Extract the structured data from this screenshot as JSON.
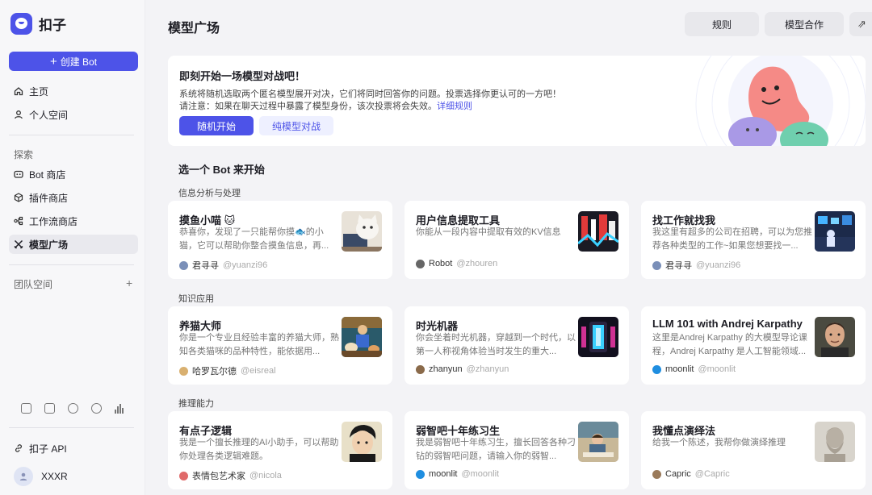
{
  "brand": {
    "name": "扣子"
  },
  "sidebar": {
    "create_label": "创建 Bot",
    "nav_top": [
      {
        "label": "主页",
        "icon": "home-icon"
      },
      {
        "label": "个人空间",
        "icon": "person-icon"
      }
    ],
    "explore_label": "探索",
    "nav_explore": [
      {
        "label": "Bot 商店",
        "icon": "bot-icon"
      },
      {
        "label": "插件商店",
        "icon": "cube-icon"
      },
      {
        "label": "工作流商店",
        "icon": "workflow-icon"
      },
      {
        "label": "模型广场",
        "icon": "arena-icon",
        "active": true
      }
    ],
    "team_label": "团队空间",
    "api_label": "扣子 API",
    "user_name": "XXXR"
  },
  "header": {
    "title": "模型广场",
    "rules_label": "规则",
    "coop_label": "模型合作"
  },
  "hero": {
    "title": "即刻开始一场模型对战吧！",
    "line1": "系统将随机选取两个匿名模型展开对决，它们将同时回答你的问题。投票选择你更认可的一方吧！",
    "line2": "请注意：如果在聊天过程中暴露了模型身份，该次投票将会失效。",
    "link": "详细规则",
    "btn_random": "随机开始",
    "btn_pure": "纯模型对战"
  },
  "pick_title": "选一个 Bot 来开始",
  "categories": [
    {
      "label": "信息分析与处理",
      "cards": [
        {
          "title": "摸鱼小喵 🐱",
          "desc": "恭喜你，发现了一只能帮你摸🐟的小猫，它可以帮助你整合摸鱼信息，再...",
          "author": "君寻寻",
          "handle": "@yuanzi96",
          "dot": "#7a8fb8"
        },
        {
          "title": "用户信息提取工具",
          "desc": "你能从一段内容中提取有效的KV信息",
          "author": "Robot",
          "handle": "@zhouren",
          "dot": "#666"
        },
        {
          "title": "找工作就找我",
          "desc": "我这里有超多的公司在招聘，可以为您推荐各种类型的工作~如果您想要找一...",
          "author": "君寻寻",
          "handle": "@yuanzi96",
          "dot": "#7a8fb8"
        }
      ]
    },
    {
      "label": "知识应用",
      "cards": [
        {
          "title": "养猫大师",
          "desc": "你是一个专业且经验丰富的养猫大师，熟知各类猫咪的品种特性，能依据用...",
          "author": "哈罗瓦尔德",
          "handle": "@eisreal",
          "dot": "#d9b070"
        },
        {
          "title": "时光机器",
          "desc": "你会坐着时光机器，穿越到一个时代，以第一人称视角体验当时发生的重大...",
          "author": "zhanyun",
          "handle": "@zhanyun",
          "dot": "#8a6a4a"
        },
        {
          "title": "LLM 101 with Andrej Karpathy",
          "desc": "这里是Andrej Karpathy 的大模型导论课程，Andrej Karpathy 是人工智能领域...",
          "author": "moonlit",
          "handle": "@moonlit",
          "dot": "#1f8ee0"
        }
      ]
    },
    {
      "label": "推理能力",
      "cards": [
        {
          "title": "有点子逻辑",
          "desc": "我是一个擅长推理的AI小助手，可以帮助你处理各类逻辑难题。",
          "author": "表情包艺术家",
          "handle": "@nicola",
          "dot": "#e06a6a"
        },
        {
          "title": "弱智吧十年练习生",
          "desc": "我是弱智吧十年练习生，擅长回答各种刁钻的弱智吧问题，请输入你的弱智...",
          "author": "moonlit",
          "handle": "@moonlit",
          "dot": "#1f8ee0"
        },
        {
          "title": "我懂点演绎法",
          "desc": "给我一个陈述，我帮你做演绎推理",
          "author": "Capric",
          "handle": "@Capric",
          "dot": "#9a7a5a"
        }
      ]
    }
  ]
}
